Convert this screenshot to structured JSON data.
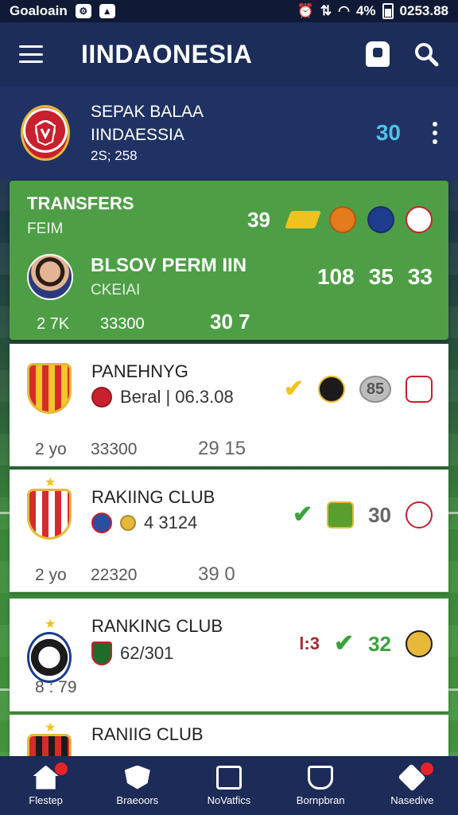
{
  "status_bar": {
    "carrier": "Goaloain",
    "battery": "4%",
    "time": "0253.88"
  },
  "header": {
    "title": "IINDAONESIA"
  },
  "league": {
    "name_line1": "SEPAK BALAA",
    "name_line2": "IINDAESSIA",
    "season": "2S; 258",
    "score": "30"
  },
  "featured": {
    "title": "TRANSFERS",
    "subtitle": "FEIM",
    "top_score": "39",
    "player_name": "BLSOV PERM IIN",
    "player_sub": "CKEIAI",
    "stats": [
      "108",
      "35",
      "33"
    ],
    "bottom": [
      "2 7K",
      "33300",
      "30  7"
    ]
  },
  "clubs": [
    {
      "name": "PANEHNYG",
      "detail": "Beral | 06.3.08",
      "badge_text": "85",
      "bottom": [
        "2 yo",
        "33300",
        "29 15"
      ]
    },
    {
      "name": "RAKIING CLUB",
      "detail": "4 3124",
      "badge_text": "30",
      "bottom": [
        "2 yo",
        "22320",
        "39  0"
      ]
    },
    {
      "name": "RANKING CLUB",
      "detail": "62/301",
      "badge_text": "32",
      "extra_text": "l:3",
      "bottom": [
        "8 : 79"
      ]
    },
    {
      "name": "RANIIG CLUB"
    }
  ],
  "bottom_nav": [
    {
      "label": "Flestep",
      "icon": "home-icon"
    },
    {
      "label": "Braeoors",
      "icon": "shield-icon"
    },
    {
      "label": "NoVatfics",
      "icon": "notifications-icon"
    },
    {
      "label": "Bornpbran",
      "icon": "team-icon"
    },
    {
      "label": "Nasedive",
      "icon": "layers-icon"
    }
  ],
  "colors": {
    "header_bg": "#1d2d5a",
    "featured_bg": "#4e9e46",
    "accent_score": "#4ec3e8",
    "check_yellow": "#f1c21c",
    "check_green": "#3aa33a",
    "notification_red": "#e3242b"
  }
}
